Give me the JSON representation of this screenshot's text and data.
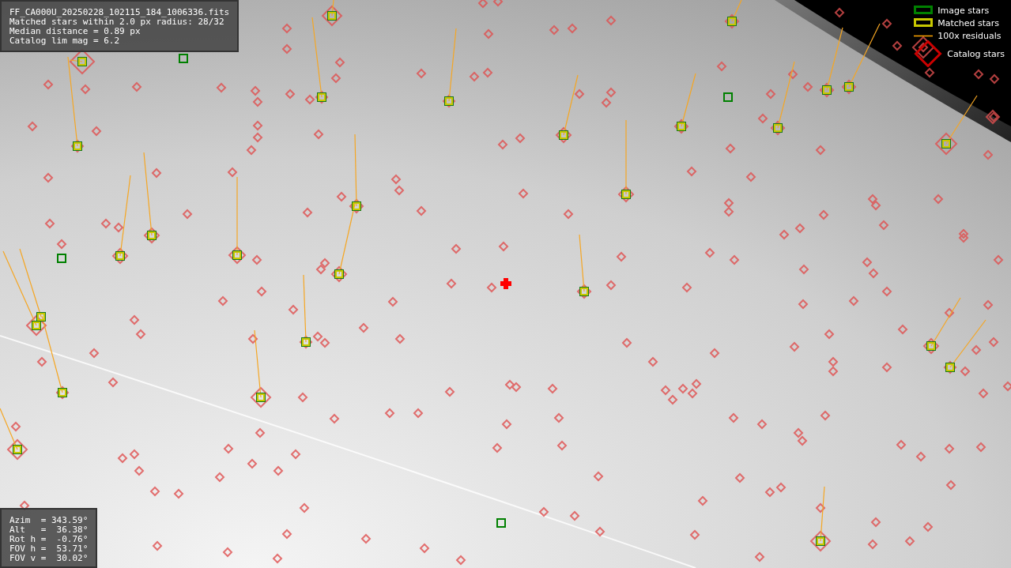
{
  "info_box": {
    "lines": [
      "FF_CA000U_20250228_102115_184_1006336.fits",
      "Matched stars within 2.0 px radius: 28/32",
      "Median distance = 0.89 px",
      "Catalog lim mag = 6.2"
    ]
  },
  "legend": [
    {
      "kind": "image",
      "label": "Image stars",
      "color": "#008000"
    },
    {
      "kind": "matched",
      "label": "Matched stars",
      "color": "#c8c800"
    },
    {
      "kind": "residual",
      "label": "100x residuals",
      "color": "#ffa500"
    },
    {
      "kind": "catalog",
      "label": "Catalog stars",
      "color": "#cc0000"
    }
  ],
  "pointing_box": {
    "lines": [
      "Azim  = 343.59°",
      "Alt   =  36.38°",
      "Rot h =  -0.76°",
      "FOV h =  53.71°",
      "FOV v =  30.02°"
    ]
  }
}
